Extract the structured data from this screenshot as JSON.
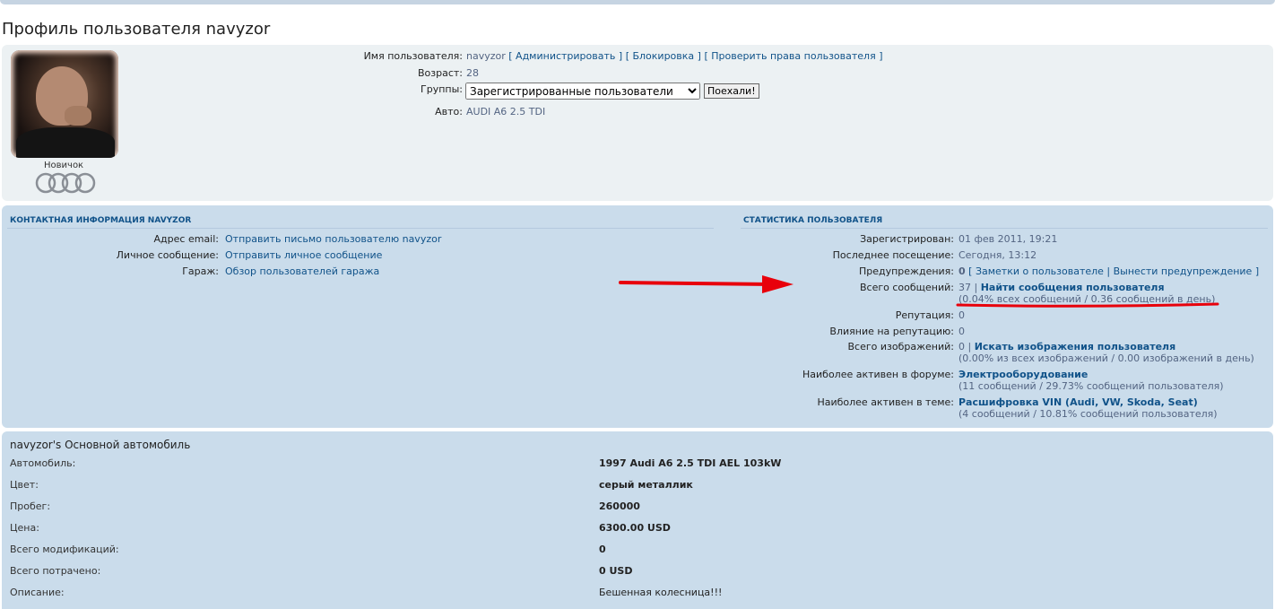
{
  "page": {
    "title": "Профиль пользователя navyzor"
  },
  "profile": {
    "rank": "Новичок",
    "rows": {
      "username": {
        "label": "Имя пользователя:",
        "value": "navyzor",
        "links": [
          "[ Администрировать ]",
          "[ Блокировка ]",
          "[ Проверить права пользователя ]"
        ]
      },
      "age": {
        "label": "Возраст:",
        "value": "28"
      },
      "groups": {
        "label": "Группы:",
        "selected": "Зарегистрированные пользователи",
        "button": "Поехали!"
      },
      "car": {
        "label": "Авто:",
        "value": "AUDI A6 2.5 TDI"
      }
    }
  },
  "contact": {
    "heading": "КОНТАКТНАЯ ИНФОРМАЦИЯ NAVYZOR",
    "rows": [
      {
        "label": "Адрес email:",
        "value": "Отправить письмо пользователю navyzor"
      },
      {
        "label": "Личное сообщение:",
        "value": "Отправить личное сообщение"
      },
      {
        "label": "Гараж:",
        "value": "Обзор пользователей гаража"
      }
    ]
  },
  "stats": {
    "heading": "СТАТИСТИКА ПОЛЬЗОВАТЕЛЯ",
    "registered": {
      "label": "Зарегистрирован:",
      "value": "01 фев 2011, 19:21"
    },
    "last_visit": {
      "label": "Последнее посещение:",
      "value": "Сегодня, 13:12"
    },
    "warnings": {
      "label": "Предупреждения:",
      "count": "0",
      "links": "[ Заметки о пользователе | Вынести предупреждение ]"
    },
    "posts": {
      "label": "Всего сообщений:",
      "count": "37",
      "link": "Найти сообщения пользователя",
      "sub": "(0.04% всех сообщений / 0.36 сообщений в день)"
    },
    "reputation": {
      "label": "Репутация:",
      "value": "0"
    },
    "rep_influence": {
      "label": "Влияние на репутацию:",
      "value": "0"
    },
    "images": {
      "label": "Всего изображений:",
      "count": "0",
      "link": "Искать изображения пользователя",
      "sub": "(0.00% из всех изображений / 0.00 изображений в день)"
    },
    "active_forum": {
      "label": "Наиболее активен в форуме:",
      "value": "Электрооборудование",
      "sub": "(11 сообщений / 29.73% сообщений пользователя)"
    },
    "active_topic": {
      "label": "Наиболее активен в теме:",
      "value": "Расшифровка VIN (Audi, VW, Skoda, Seat)",
      "sub": "(4 сообщений / 10.81% сообщений пользователя)"
    }
  },
  "vehicle": {
    "title": "navyzor's Основной автомобиль",
    "rows": [
      {
        "label": "Автомобиль:",
        "value": "1997 Audi A6 2.5 TDI AEL 103kW"
      },
      {
        "label": "Цвет:",
        "value": "серый металлик"
      },
      {
        "label": "Пробег:",
        "value": "260000"
      },
      {
        "label": "Цена:",
        "value": "6300.00 USD"
      },
      {
        "label": "Всего модификаций:",
        "value": "0"
      },
      {
        "label": "Всего потрачено:",
        "value": "0 USD"
      },
      {
        "label": "Описание:",
        "value": "Бешенная колесница!!!"
      }
    ]
  },
  "colors": {
    "link": "#105289",
    "panel_light": "#ecf1f3",
    "panel_blue": "#cadceb",
    "annotation": "#e8000b"
  }
}
